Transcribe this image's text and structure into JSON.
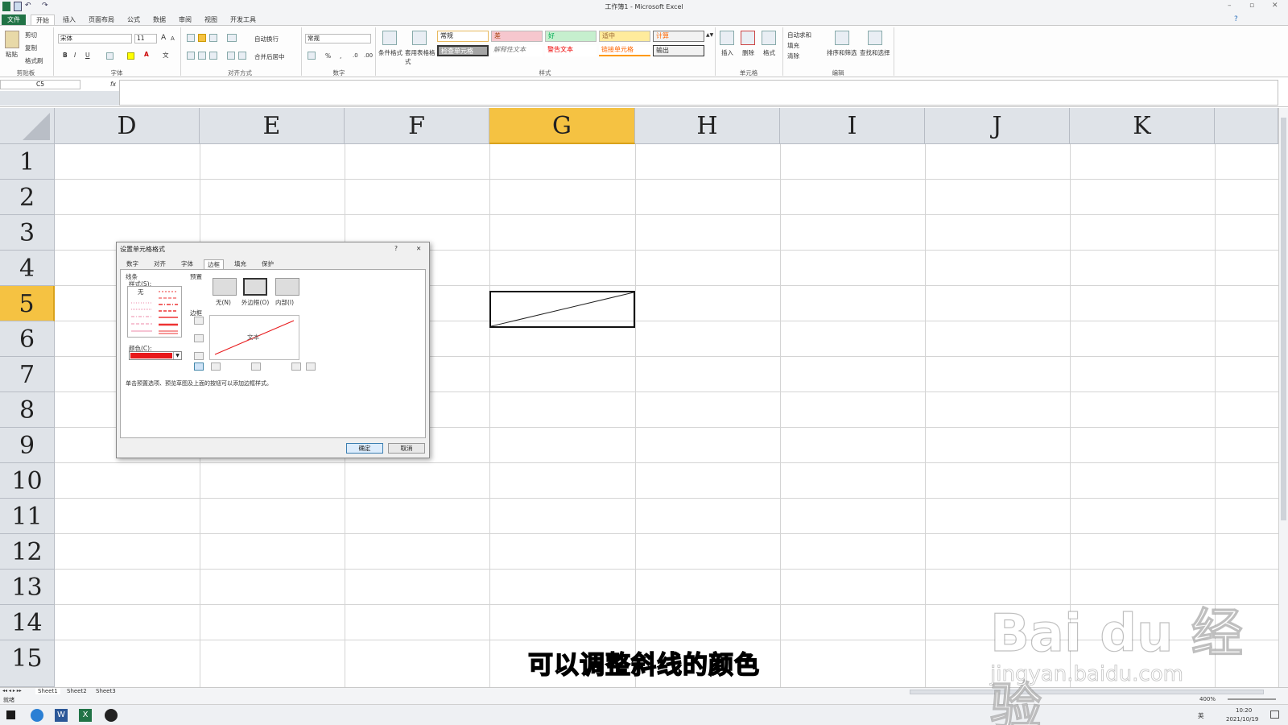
{
  "window": {
    "title": "工作簿1 - Microsoft Excel"
  },
  "ribbon_tabs": [
    "文件",
    "开始",
    "插入",
    "页面布局",
    "公式",
    "数据",
    "审阅",
    "视图",
    "开发工具"
  ],
  "ribbon": {
    "clipboard": {
      "paste": "粘贴",
      "cut": "剪切",
      "copy": "复制",
      "format_painter": "格式刷",
      "label": "剪贴板"
    },
    "font": {
      "name": "宋体",
      "size": "11",
      "label": "字体"
    },
    "alignment": {
      "wrap": "自动换行",
      "merge": "合并后居中",
      "label": "对齐方式"
    },
    "number": {
      "format": "常规",
      "label": "数字"
    },
    "styles": {
      "conditional": "条件格式",
      "table": "套用表格格式",
      "cells": [
        "常规",
        "差",
        "好",
        "适中",
        "计算",
        "检查单元格",
        "解释性文本",
        "警告文本",
        "链接单元格",
        "输出"
      ],
      "label": "样式"
    },
    "cells_group": {
      "insert": "插入",
      "delete": "删除",
      "format": "格式",
      "label": "单元格"
    },
    "editing": {
      "autosum": "自动求和",
      "fill": "填充",
      "clear": "清除",
      "sort": "排序和筛选",
      "find": "查找和选择",
      "label": "编辑"
    }
  },
  "formula_bar": {
    "name_box": "C5",
    "fx": "fx"
  },
  "columns": [
    "D",
    "E",
    "F",
    "G",
    "H",
    "I",
    "J",
    "K"
  ],
  "rows": [
    "1",
    "2",
    "3",
    "4",
    "5",
    "6",
    "7",
    "8",
    "9",
    "10",
    "11",
    "12",
    "13",
    "14",
    "15"
  ],
  "selected": {
    "column": "G",
    "row": "5"
  },
  "dialog": {
    "title": "设置单元格格式",
    "help": "?",
    "close": "✕",
    "tabs": [
      "数字",
      "对齐",
      "字体",
      "边框",
      "填充",
      "保护"
    ],
    "active_tab": "边框",
    "line_section": "线条",
    "style_label": "样式(S):",
    "style_none": "无",
    "color_label": "颜色(C):",
    "line_color": "#e8191b",
    "preset_label": "预置",
    "presets": [
      "无(N)",
      "外边框(O)",
      "内部(I)"
    ],
    "border_label": "边框",
    "preview_text": "文本",
    "hint": "单击预置选项、预览草图及上面的按钮可以添加边框样式。",
    "ok": "确定",
    "cancel": "取消"
  },
  "sheet_tabs": [
    "Sheet1",
    "Sheet2",
    "Sheet3"
  ],
  "status": {
    "mode": "就绪",
    "zoom": "400%"
  },
  "taskbar": {
    "ime": "英",
    "time": "10:20",
    "date": "2021/10/19"
  },
  "subtitle": "可以调整斜线的颜色",
  "watermark": {
    "logo": "Bai du 经验",
    "url": "jingyan.baidu.com"
  }
}
